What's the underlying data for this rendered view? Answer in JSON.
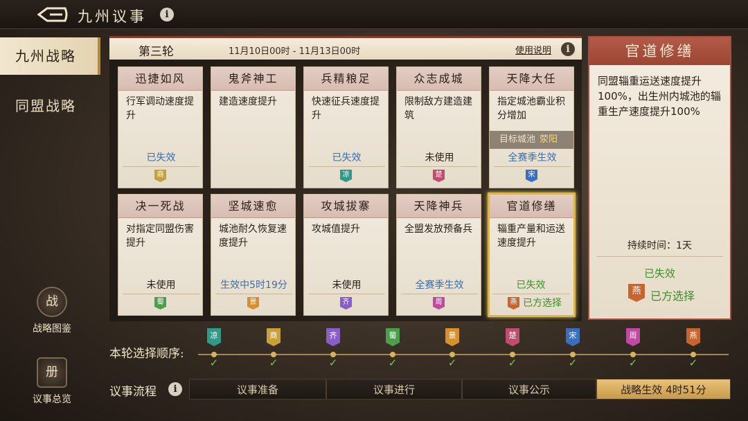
{
  "header": {
    "title": "九州议事"
  },
  "sidebar": {
    "tabs": [
      {
        "label": "九州战略"
      },
      {
        "label": "同盟战略"
      }
    ],
    "tools": [
      {
        "label": "战略图鉴",
        "icon": "战"
      },
      {
        "label": "议事总览",
        "icon": "册"
      }
    ]
  },
  "round": {
    "label": "第三轮",
    "dates": "11月10日00时 - 11月13日00时",
    "usage_label": "使用说明"
  },
  "cards": [
    {
      "title": "迅捷如风",
      "desc": "行军调动速度提升",
      "status": "已失效",
      "flag": "商",
      "flag_color": "#c8a03a"
    },
    {
      "title": "鬼斧神工",
      "desc": "建造速度提升",
      "status": "",
      "flag": "",
      "flag_color": ""
    },
    {
      "title": "兵精粮足",
      "desc": "快速征兵速度提升",
      "status": "已失效",
      "flag": "凉",
      "flag_color": "#2f9a8a"
    },
    {
      "title": "众志成城",
      "desc": "限制敌方建造建筑",
      "status": "未使用",
      "flag": "楚",
      "flag_color": "#c04d6e"
    },
    {
      "title": "天降大任",
      "desc": "指定城池霸业积分增加",
      "status": "全赛季生效",
      "flag": "宋",
      "flag_color": "#3a6fc0",
      "target_label": "目标城池",
      "target_city": "荥阳"
    },
    {
      "title": "决一死战",
      "desc": "对指定同盟伤害提升",
      "status": "未使用",
      "flag": "蜀",
      "flag_color": "#4aa04a"
    },
    {
      "title": "坚城速愈",
      "desc": "城池耐久恢复速度提升",
      "status": "生效中5时19分",
      "flag": "景",
      "flag_color": "#d8902e"
    },
    {
      "title": "攻城拔寨",
      "desc": "攻城值提升",
      "status": "未使用",
      "flag": "齐",
      "flag_color": "#8a5ec8"
    },
    {
      "title": "天降神兵",
      "desc": "全盟发放预备兵",
      "status": "全赛季生效",
      "flag": "周",
      "flag_color": "#c04aa0"
    },
    {
      "title": "官道修缮",
      "desc": "辎重产量和运送速度提升",
      "status": "已失效",
      "flag": "燕",
      "flag_color": "#c8642e",
      "flag_note": "已方选择"
    }
  ],
  "detail": {
    "title": "官道修缮",
    "desc": "同盟辎重运送速度提升100%，出生州内城池的辎重生产速度提升100%",
    "duration": "持续时间：1天",
    "status": "已失效",
    "flag": "燕",
    "flag_color": "#c8642e",
    "flag_note": "已方选择"
  },
  "order": {
    "label": "本轮选择顺序:",
    "items": [
      {
        "flag": "凉",
        "color": "#2f9a8a"
      },
      {
        "flag": "商",
        "color": "#c8a03a"
      },
      {
        "flag": "齐",
        "color": "#8a5ec8"
      },
      {
        "flag": "蜀",
        "color": "#4aa04a"
      },
      {
        "flag": "景",
        "color": "#d8902e"
      },
      {
        "flag": "楚",
        "color": "#c04d6e"
      },
      {
        "flag": "宋",
        "color": "#3a6fc0"
      },
      {
        "flag": "周",
        "color": "#c04aa0"
      },
      {
        "flag": "燕",
        "color": "#c8642e"
      }
    ]
  },
  "process": {
    "label": "议事流程",
    "steps": [
      "议事准备",
      "议事进行",
      "议事公示",
      "战略生效 4时51分"
    ]
  }
}
